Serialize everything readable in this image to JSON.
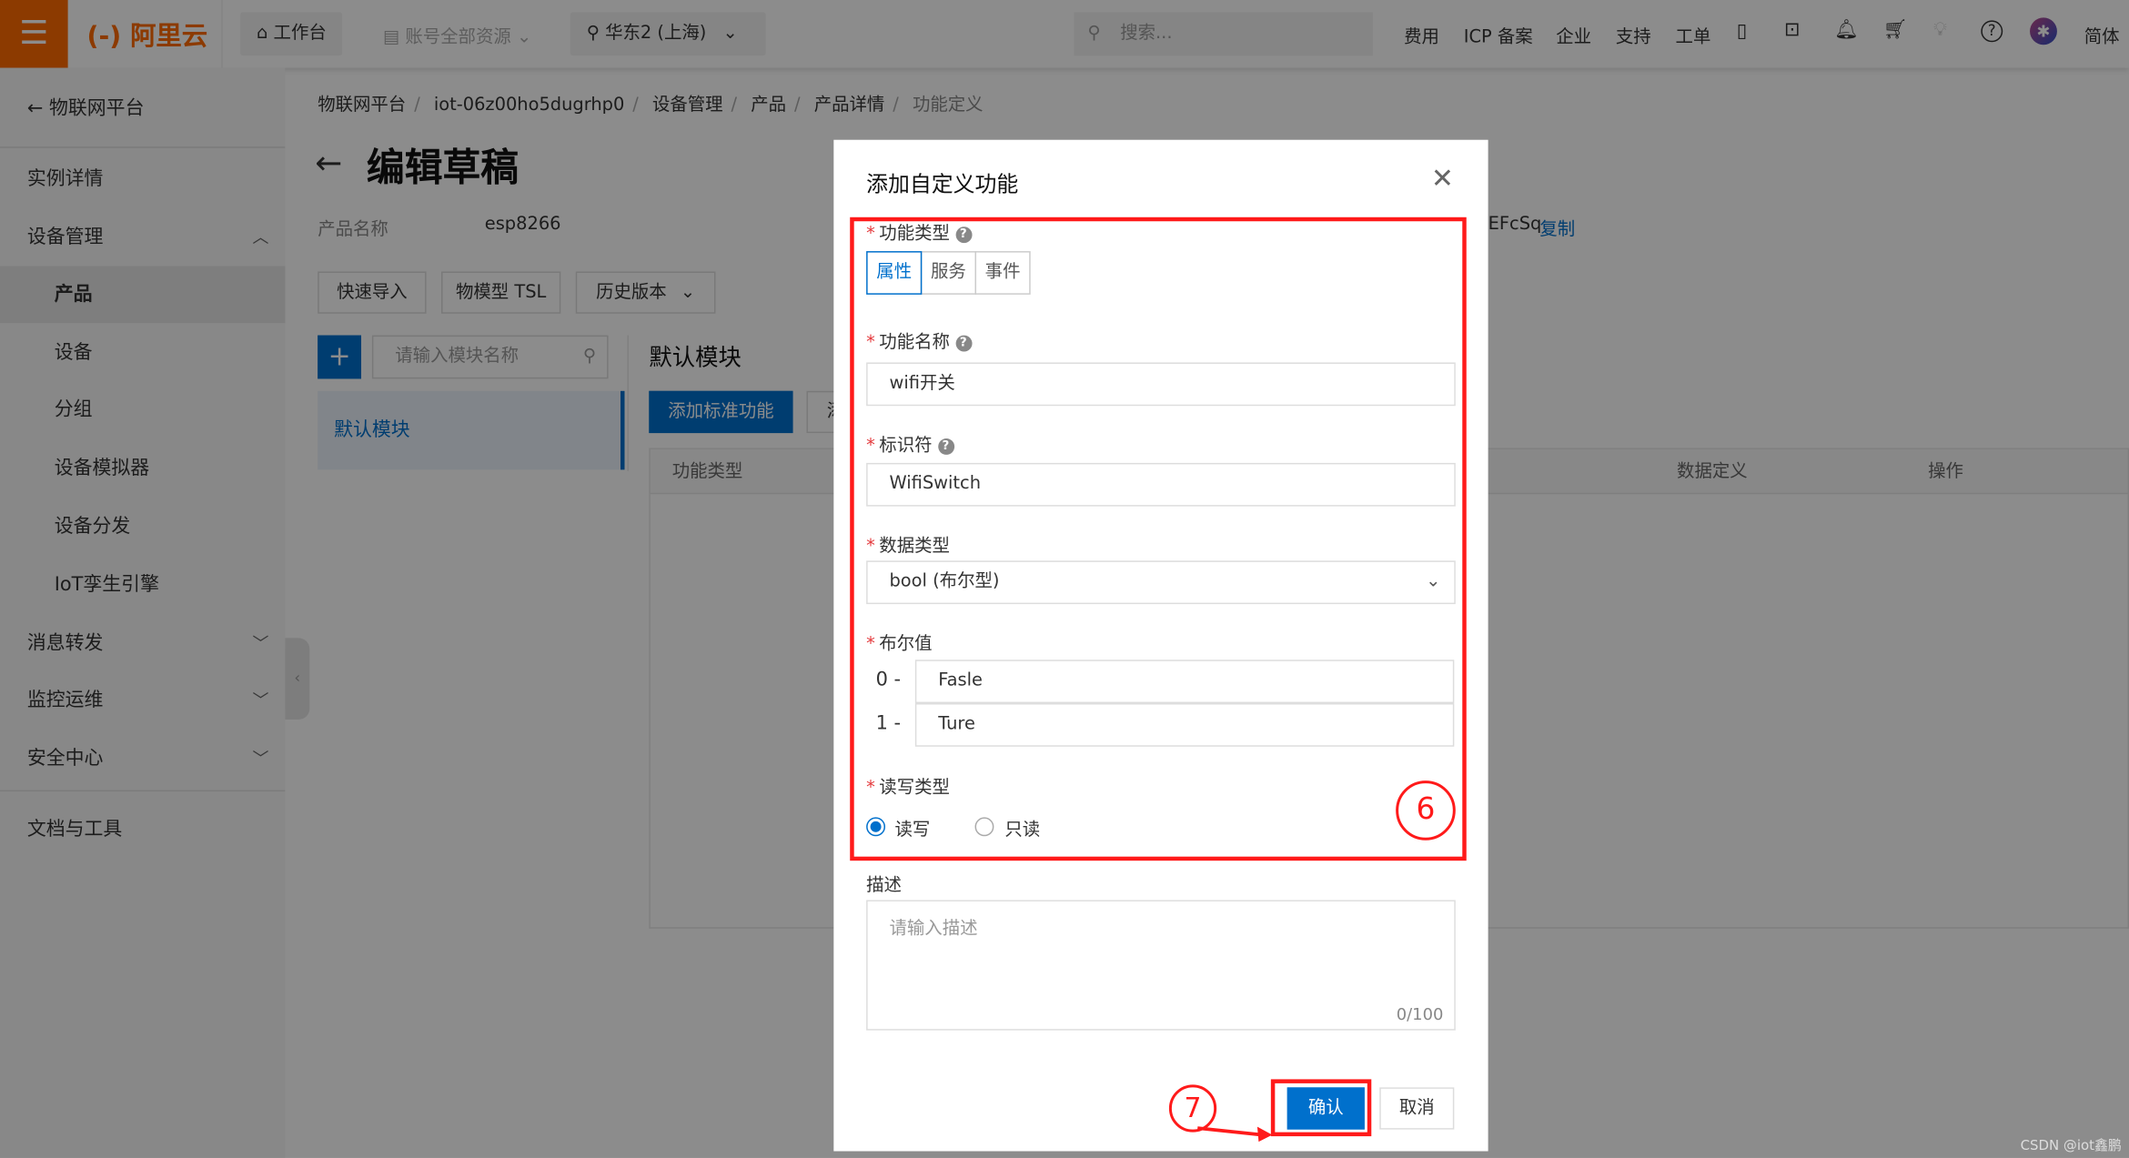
{
  "topbar": {
    "logo": "(-) 阿里云",
    "workbench": "工作台",
    "resources": "账号全部资源",
    "region": "华东2 (上海)",
    "search_placeholder": "搜索...",
    "links": [
      "费用",
      "ICP 备案",
      "企业",
      "支持",
      "工单"
    ],
    "lang": "简体",
    "icons": [
      "app-icon",
      "terminal-icon",
      "bell-icon",
      "cart-icon",
      "bulb-icon",
      "help-icon",
      "avatar"
    ],
    "brand_color": "#ff6a00"
  },
  "sidebar": {
    "back": "物联网平台",
    "items": [
      "实例详情",
      "设备管理",
      "产品",
      "设备",
      "分组",
      "设备模拟器",
      "设备分发",
      "IoT孪生引擎",
      "消息转发",
      "监控运维",
      "安全中心",
      "文档与工具"
    ],
    "selected": "产品"
  },
  "breadcrumb": [
    "物联网平台",
    "iot-06z00ho5dugrhp0",
    "设备管理",
    "产品",
    "产品详情",
    "功能定义"
  ],
  "page": {
    "title": "编辑草稿",
    "product_name_label": "产品名称",
    "product_name": "esp8266",
    "product_key_tail": "EFcSq",
    "copy": "复制",
    "buttons": [
      "快速导入",
      "物模型 TSL",
      "历史版本"
    ],
    "module_search_placeholder": "请输入模块名称",
    "module_item": "默认模块",
    "module_heading": "默认模块",
    "add_std": "添加标准功能",
    "add_custom_partial": "添",
    "table_headers": [
      "功能类型",
      "数据定义",
      "操作"
    ]
  },
  "modal": {
    "title": "添加自定义功能",
    "type_label": "功能类型",
    "types": [
      "属性",
      "服务",
      "事件"
    ],
    "selected_type": "属性",
    "name_label": "功能名称",
    "name_value": "wifi开关",
    "id_label": "标识符",
    "id_value": "WifiSwitch",
    "datatype_label": "数据类型",
    "datatype_value": "bool (布尔型)",
    "bool_label": "布尔值",
    "bool0_key": "0 -",
    "bool0_value": "Fasle",
    "bool1_key": "1 -",
    "bool1_value": "Ture",
    "rw_label": "读写类型",
    "rw_options": [
      "读写",
      "只读"
    ],
    "rw_selected": "读写",
    "desc_label": "描述",
    "desc_placeholder": "请输入描述",
    "desc_counter": "0/100",
    "confirm": "确认",
    "cancel": "取消"
  },
  "annotations": {
    "step6": "6",
    "step7": "7",
    "color": "#ff1a1a"
  },
  "watermark": "CSDN @iot鑫鹏"
}
